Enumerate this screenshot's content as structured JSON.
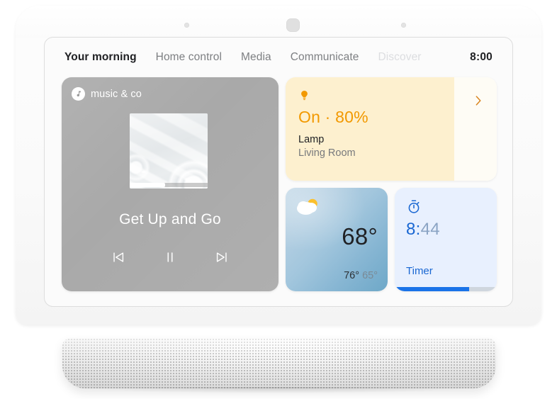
{
  "device": {
    "name": "smart-display",
    "sensors": [
      "sensor-left",
      "sensor-center",
      "sensor-right"
    ]
  },
  "tabs": [
    {
      "label": "Your morning",
      "state": "active"
    },
    {
      "label": "Home control",
      "state": "inactive"
    },
    {
      "label": "Media",
      "state": "inactive"
    },
    {
      "label": "Communicate",
      "state": "inactive"
    },
    {
      "label": "Discover",
      "state": "faded"
    }
  ],
  "clock": "8:00",
  "music": {
    "provider_name": "music & co",
    "provider_icon": "music-note-icon",
    "track_title": "Get Up and Go",
    "progress_percent": 45,
    "background_color": "#a9a9a9",
    "controls": [
      {
        "name": "previous-track-button",
        "icon": "skip-previous-icon"
      },
      {
        "name": "pause-button",
        "icon": "pause-icon"
      },
      {
        "name": "next-track-button",
        "icon": "skip-next-icon"
      }
    ]
  },
  "lamp": {
    "icon": "lightbulb-icon",
    "state_text": "On · 80%",
    "brightness_percent": 80,
    "device_name": "Lamp",
    "room_name": "Living Room",
    "chevron_icon": "chevron-right-icon",
    "accent_color": "#f29900",
    "fill_color": "#fdf0cf",
    "background_color": "#fefcf5"
  },
  "weather": {
    "icon": "partly-cloudy-icon",
    "temperature": "68°",
    "high": "76°",
    "low": "65°"
  },
  "timer": {
    "icon": "stopwatch-icon",
    "remaining": "8:",
    "elapsed": "44",
    "label": "Timer",
    "progress_percent": 73,
    "accent_color": "#1a73e8",
    "background_color": "#e8f0fe"
  }
}
